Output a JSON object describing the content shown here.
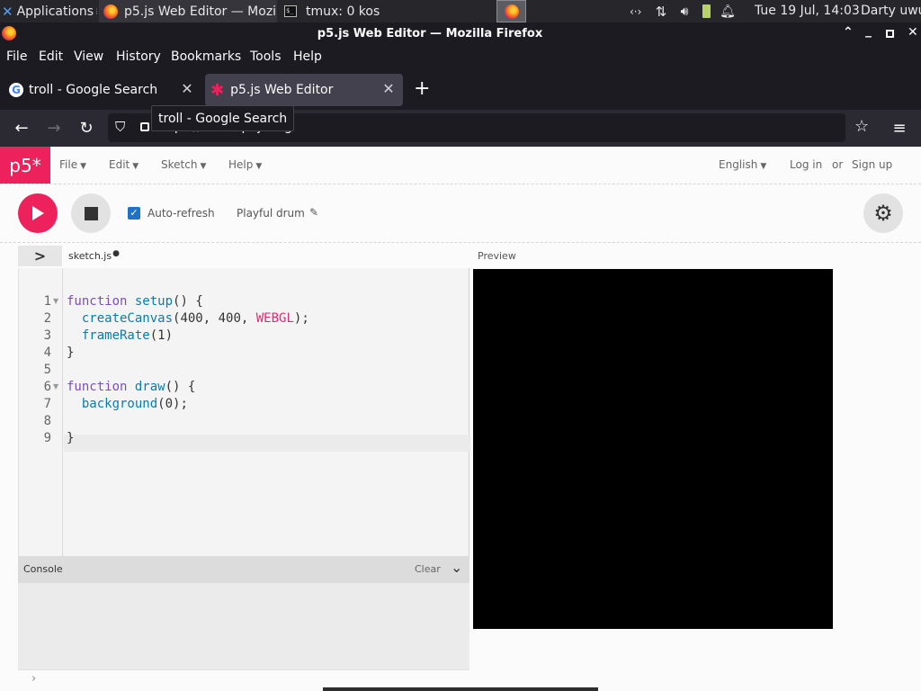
{
  "taskbar": {
    "applications": "Applications",
    "window_firefox": "p5.js Web Editor — Mozi...",
    "window_tmux": "tmux: 0 kos",
    "clock": "Tue 19 Jul, 14:03",
    "user": "Darty uwu"
  },
  "window": {
    "title": "p5.js Web Editor — Mozilla Firefox"
  },
  "menubar": {
    "file": "File",
    "edit": "Edit",
    "view": "View",
    "history": "History",
    "bookmarks": "Bookmarks",
    "tools": "Tools",
    "help": "Help"
  },
  "tabs": [
    {
      "label": "troll - Google Search"
    },
    {
      "label": "p5.js Web Editor"
    }
  ],
  "navbar": {
    "url": "https://editor.p5js.org",
    "tooltip": "troll - Google Search"
  },
  "p5": {
    "logo": "p5*",
    "menu": {
      "file": "File",
      "edit": "Edit",
      "sketch": "Sketch",
      "help": "Help"
    },
    "language": "English",
    "login": "Log in",
    "or": "or",
    "signup": "Sign up",
    "auto_refresh": "Auto-refresh",
    "sketch_name": "Playful drum",
    "file_tab": "sketch.js",
    "preview_label": "Preview",
    "console_label": "Console",
    "clear_label": "Clear",
    "code_lines": [
      {
        "n": "1",
        "text": "function setup() {"
      },
      {
        "n": "2",
        "text": "  createCanvas(400, 400, WEBGL);"
      },
      {
        "n": "3",
        "text": "  frameRate(1)"
      },
      {
        "n": "4",
        "text": "}"
      },
      {
        "n": "5",
        "text": ""
      },
      {
        "n": "6",
        "text": "function draw() {"
      },
      {
        "n": "7",
        "text": "  background(0);"
      },
      {
        "n": "8",
        "text": ""
      },
      {
        "n": "9",
        "text": "}"
      }
    ]
  },
  "colors": {
    "p5_pink": "#ed225d",
    "checkbox_blue": "#1e73c8",
    "firefox_dark": "#1c1b22"
  }
}
